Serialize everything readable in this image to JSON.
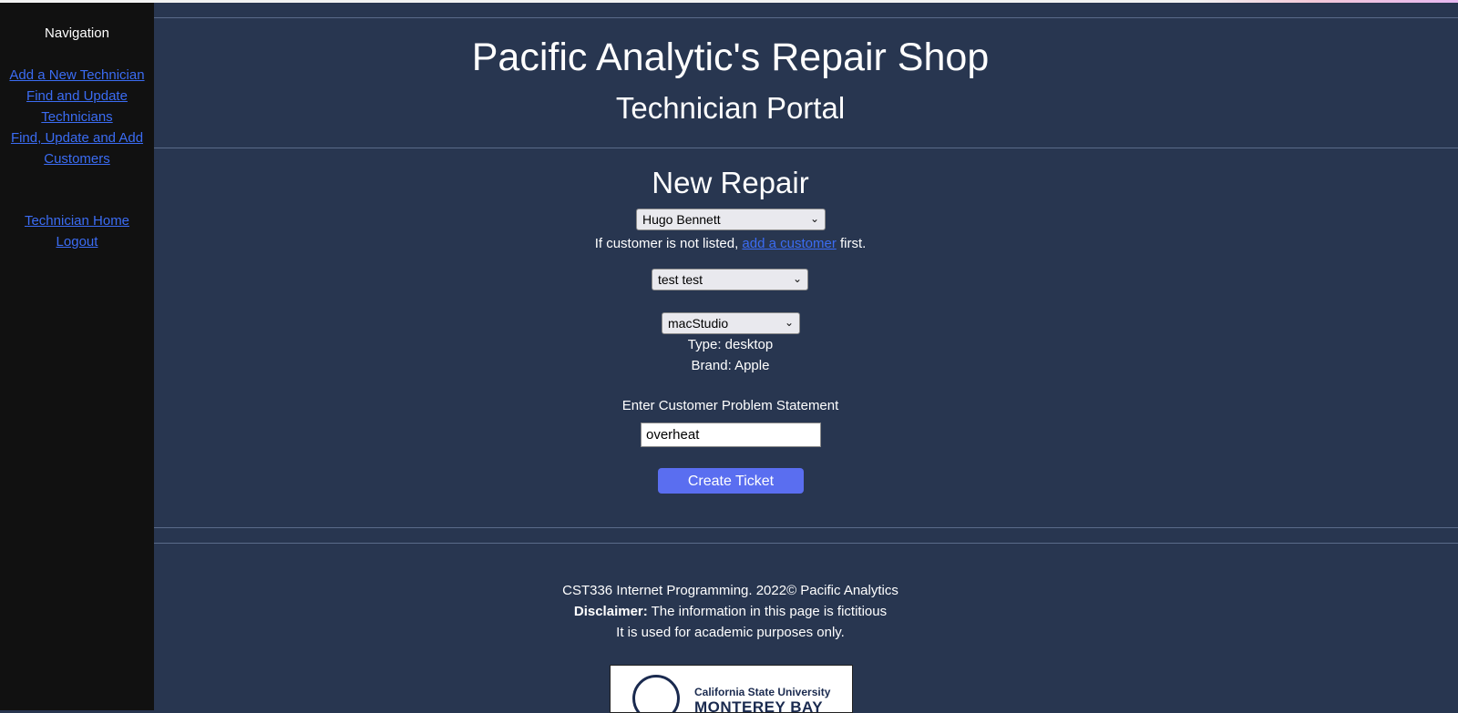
{
  "sidebar": {
    "title": "Navigation",
    "links": [
      {
        "label_lines": [
          "Add a New Technician"
        ]
      },
      {
        "label_lines": [
          "Find and Update",
          "Technicians"
        ]
      },
      {
        "label_lines": [
          "Find, Update and Add",
          "Customers"
        ]
      }
    ],
    "bottom_links": [
      {
        "label": "Technician Home"
      },
      {
        "label": "Logout"
      }
    ]
  },
  "header": {
    "title": "Pacific Analytic's Repair Shop",
    "subtitle": "Technician Portal"
  },
  "form": {
    "title": "New Repair",
    "customer_select": {
      "selected": "Hugo Bennett"
    },
    "customer_note": {
      "before": "If customer is not listed, ",
      "link": "add a customer",
      "after": " first."
    },
    "technician_select": {
      "selected": "test test"
    },
    "device_select": {
      "selected": "macStudio"
    },
    "device_type": "Type: desktop",
    "device_brand": "Brand: Apple",
    "problem_label": "Enter Customer Problem Statement",
    "problem_value": "overheat",
    "submit_label": "Create Ticket"
  },
  "footer": {
    "line1": "CST336 Internet Programming. 2022© Pacific Analytics",
    "disclaimer_label": "Disclaimer:",
    "disclaimer_text": " The information in this page is fictitious",
    "line3": "It is used for academic purposes only.",
    "logo_text_1": "California State University",
    "logo_text_2": "MONTEREY BAY"
  },
  "icons": {
    "chevron": "chevron-down-icon",
    "logo_seal": "otter-seal-icon"
  }
}
